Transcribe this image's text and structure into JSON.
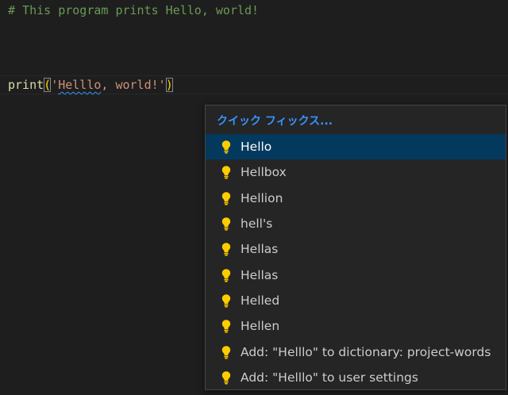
{
  "editor": {
    "comment_line": "# This program prints Hello, world!",
    "print_line": {
      "func": "print",
      "open_paren": "(",
      "quote_open": "'",
      "misspelled": "Helllo",
      "rest": ", world!'",
      "close_paren": ")"
    }
  },
  "quick_fix": {
    "title": "クイック フィックス...",
    "selected_index": 0,
    "items": [
      {
        "label": "Hello",
        "icon": "lightbulb-icon"
      },
      {
        "label": "Hellbox",
        "icon": "lightbulb-icon"
      },
      {
        "label": "Hellion",
        "icon": "lightbulb-icon"
      },
      {
        "label": "hell's",
        "icon": "lightbulb-icon"
      },
      {
        "label": "Hellas",
        "icon": "lightbulb-icon"
      },
      {
        "label": "Hellas",
        "icon": "lightbulb-icon"
      },
      {
        "label": "Helled",
        "icon": "lightbulb-icon"
      },
      {
        "label": "Hellen",
        "icon": "lightbulb-icon"
      },
      {
        "label": "Add: \"Helllo\" to dictionary: project-words",
        "icon": "lightbulb-icon"
      },
      {
        "label": "Add: \"Helllo\" to user settings",
        "icon": "lightbulb-icon"
      }
    ]
  },
  "colors": {
    "editor_background": "#1e1e1e",
    "comment": "#6a9955",
    "function": "#dcdcaa",
    "string": "#ce9178",
    "bracket": "#ffd700",
    "accent": "#3794ff",
    "selection": "#04395e",
    "lightbulb": "#ffcc00"
  }
}
